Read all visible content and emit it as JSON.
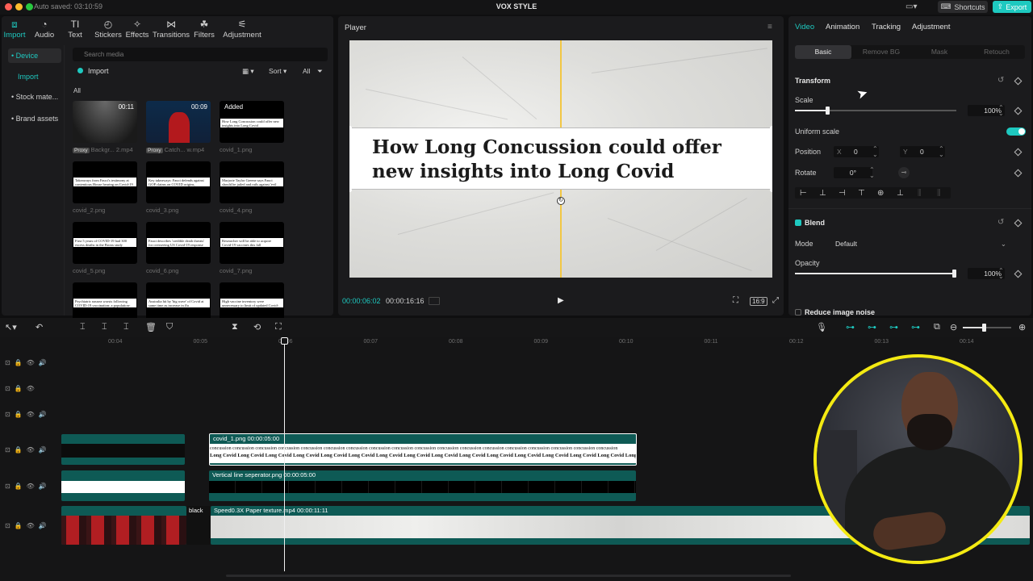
{
  "app": {
    "autosave": "Auto saved: 03:10:59",
    "title": "VOX STYLE",
    "shortcuts": "Shortcuts",
    "export": "Export"
  },
  "colors": {
    "accent": "#1ec9c0",
    "guide": "#f2c744",
    "webcam_ring": "#f4ea12"
  },
  "toolbar": [
    {
      "label": "Import",
      "icon": "import-icon"
    },
    {
      "label": "Audio",
      "icon": "audio-icon"
    },
    {
      "label": "Text",
      "icon": "text-icon"
    },
    {
      "label": "Stickers",
      "icon": "stickers-icon"
    },
    {
      "label": "Effects",
      "icon": "effects-icon"
    },
    {
      "label": "Transitions",
      "icon": "transitions-icon"
    },
    {
      "label": "Filters",
      "icon": "filters-icon"
    },
    {
      "label": "Adjustment",
      "icon": "adjustment-icon"
    }
  ],
  "media": {
    "sidebar": [
      "• Device",
      "Import",
      "• Stock mate...",
      "• Brand assets"
    ],
    "search_placeholder": "Search media",
    "import_label": "Import",
    "sort": "Sort",
    "all_filter": "All",
    "all_label": "All",
    "items": [
      {
        "caption": "Backgr... 2.mp4",
        "proxy": "Proxy",
        "duration": "00:11",
        "strip": ""
      },
      {
        "caption": "Catch... w.mp4",
        "proxy": "Proxy",
        "duration": "00:09",
        "strip": ""
      },
      {
        "caption": "covid_1.png",
        "proxy": "",
        "duration": "Added",
        "strip": "How Long Concussion could offer new insights into Long Covid"
      },
      {
        "caption": "covid_2.png",
        "proxy": "",
        "duration": "",
        "strip": "Takeaways from Fauci's testimony at contentious House hearing on Covid-19 pandemic"
      },
      {
        "caption": "covid_3.png",
        "proxy": "",
        "duration": "",
        "strip": "Key takeaways: Fauci defends against GOP claims on COVID origins, response"
      },
      {
        "caption": "covid_4.png",
        "proxy": "",
        "duration": "",
        "strip": "Marjorie Taylor Greene says Fauci should be jailed and rails against 'evil science' at Covid hearing"
      },
      {
        "caption": "covid_5.png",
        "proxy": "",
        "duration": "",
        "strip": "First 5 years of COVID-19 had 300 excess deaths in the Bronx study"
      },
      {
        "caption": "covid_6.png",
        "proxy": "",
        "duration": "",
        "strip": "Fauci describes 'credible death threats' for overseeing US Covid-19 response"
      },
      {
        "caption": "covid_7.png",
        "proxy": "",
        "duration": "",
        "strip": "Researcher will be able to acquire Covid-19 vaccines this fall"
      },
      {
        "caption": "",
        "proxy": "",
        "duration": "",
        "strip": "Psychiatric nausea worsts following COVID-19 vaccination: a population-based cohort study in Korea South Korea"
      },
      {
        "caption": "",
        "proxy": "",
        "duration": "",
        "strip": "Australia hit by 'big wave' of Covid at same time as increase in flu"
      },
      {
        "caption": "",
        "proxy": "",
        "duration": "",
        "strip": "High vaccine inventory were unnecessary to limit of updated Covid-19 shot for fall"
      }
    ]
  },
  "player": {
    "title": "Player",
    "headline": "How Long Concussion could offer new insights into Long Covid",
    "time_current": "00:00:06:02",
    "time_total": "00:00:16:16",
    "ratio": "16:9"
  },
  "inspector": {
    "tabs": [
      "Video",
      "Animation",
      "Tracking",
      "Adjustment"
    ],
    "subtabs": [
      "Basic",
      "Remove BG",
      "Mask",
      "Retouch"
    ],
    "transform": "Transform",
    "scale_label": "Scale",
    "scale_value": "100%",
    "scale_level": 0.2,
    "uniform_scale": "Uniform scale",
    "position_label": "Position",
    "pos_x_label": "X",
    "pos_x": "0",
    "pos_y_label": "Y",
    "pos_y": "0",
    "rotate_label": "Rotate",
    "rotate_value": "0°",
    "blend": "Blend",
    "mode_label": "Mode",
    "mode_value": "Default",
    "opacity_label": "Opacity",
    "opacity_value": "100%",
    "opacity_level": 1.0,
    "reduce_noise": "Reduce image noise"
  },
  "timeline": {
    "ticks": [
      "00:04",
      "00:05",
      "00:06",
      "00:07",
      "00:08",
      "00:09",
      "00:10",
      "00:11",
      "00:12",
      "00:13",
      "00:14"
    ],
    "clip_covid": "covid_1.png  00:00:05:00",
    "clip_covid_words_top": "concussion concussion concussion concussion concussion concussion concussion concussion concussion concussion concussion concussion concussion concussion concussion concussion concussion concussion",
    "clip_covid_words_bottom": "Long Covid  Long Covid  Long Covid  Long Covid  Long Covid  Long Covid  Long Covid  Long Covid  Long Covid  Long Covid  Long Covid  Long Covid  Long Covid  Long Covid  Long Covid  Long Covid  Long Covid",
    "clip_separator": "Vertical line seperator.png  00:00:05:00",
    "clip_black": "black",
    "clip_paper": "Speed0.3X  Paper texture.mp4  00:00:11:11"
  }
}
